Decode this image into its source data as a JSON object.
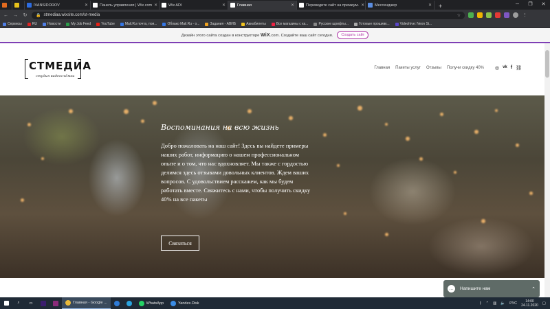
{
  "browser": {
    "tabs": [
      {
        "label": "",
        "color": "#e36b1f"
      },
      {
        "label": "",
        "color": "#e8c21b"
      },
      {
        "label": "IVANSIDOROV",
        "color": "#2d6cdf"
      },
      {
        "label": "Панель управления | Wix.com",
        "color": "#ffffff"
      },
      {
        "label": "Wix ADI",
        "color": "#ffffff"
      },
      {
        "label": "Главная",
        "color": "#ffffff"
      },
      {
        "label": "Переведите сайт на премиум-",
        "color": "#ffffff"
      },
      {
        "label": "Мессенджер",
        "color": "#5b8de0"
      }
    ],
    "active_tab": 5,
    "address": "stmediaa.wixsite.com/st-media",
    "bookmarks": [
      {
        "label": "Сервисы",
        "color": "#4f7ee6"
      },
      {
        "label": "RU",
        "color": "#d22"
      },
      {
        "label": "Новости",
        "color": "#4f7ee6"
      },
      {
        "label": "My Job Feed",
        "color": "#2c9c4a"
      },
      {
        "label": "YouTube",
        "color": "#e62117"
      },
      {
        "label": "Mail.Ru почта, пои...",
        "color": "#3577e6"
      },
      {
        "label": "Облако Mail.Ru - о...",
        "color": "#3577e6"
      },
      {
        "label": "Задания - АВИБ",
        "color": "#f1a320"
      },
      {
        "label": "Авиабилеты",
        "color": "#f1c320"
      },
      {
        "label": "Все магазины с ка...",
        "color": "#e24"
      },
      {
        "label": "Русские шрифты...",
        "color": "#888"
      },
      {
        "label": "Готовые прошивк...",
        "color": "#aaa"
      },
      {
        "label": "Videohive: Neon Si...",
        "color": "#5a45c9"
      }
    ]
  },
  "wix_banner": {
    "text_before": "Дизайн этого сайта создан в конструкторе",
    "brand": "WiX",
    "brand_suffix": ".com",
    "text_after": ". Создайте ваш сайт сегодня.",
    "button": "Создать сайт"
  },
  "site": {
    "logo": "СТМЕДИА",
    "logo_tag": "студия видеосъёмки",
    "menu": [
      "Главная",
      "Пакеты услуг",
      "Отзывы",
      "Получи скидку 40%"
    ],
    "social": [
      "instagram-icon",
      "vk-icon",
      "facebook-icon",
      "link-icon"
    ]
  },
  "hero": {
    "title": "Воспоминания на всю жизнь",
    "text": "Добро пожаловать на наш сайт! Здесь вы найдете примеры наших работ, информацию о нашем профессиональном опыте и о том, что нас вдохновляет. Мы также с гордостью делимся здесь отзывами довольных клиентов. Ждем ваших вопросов. С удовольствием расскажем, как мы будем работать вместе. Свяжитесь с нами, чтобы получить скидку 40% на все пакеты",
    "cta": "Связаться"
  },
  "chat": {
    "label": "Напишите нам"
  },
  "taskbar": {
    "apps": [
      "Главная - Google ...",
      "WhatsApp",
      "Yandex.Disk"
    ],
    "lang": "РУС",
    "time": "14:00",
    "date": "24.11.2020"
  }
}
